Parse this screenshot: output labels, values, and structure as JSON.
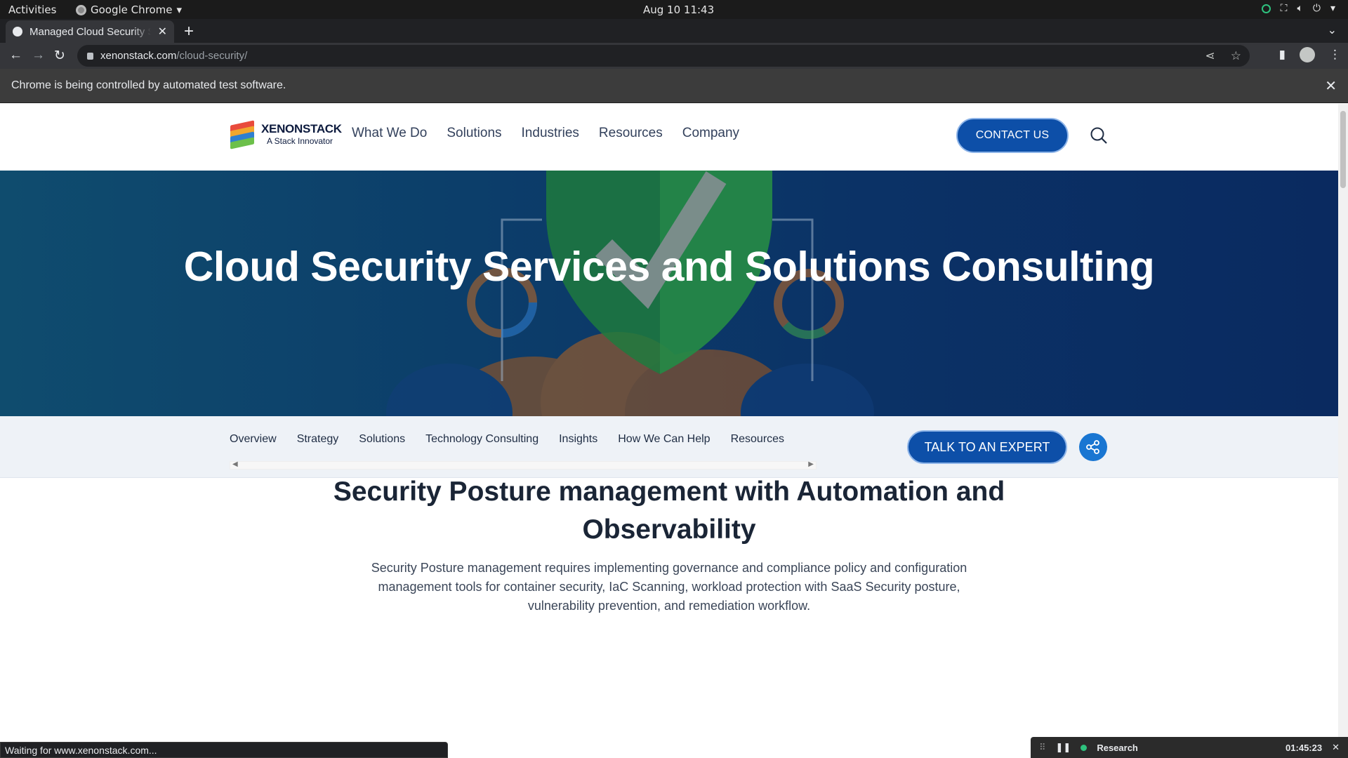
{
  "os": {
    "activities": "Activities",
    "app_name": "Google Chrome",
    "clock": "Aug 10  11:43"
  },
  "browser": {
    "tab_title": "Managed Cloud Security Services",
    "new_tab_symbol": "+",
    "url_host": "xenonstack.com",
    "url_path": "/cloud-security/",
    "infobar_message": "Chrome is being controlled by automated test software.",
    "status_text": "Waiting for www.xenonstack.com..."
  },
  "site": {
    "logo_brand": "XENONSTACK",
    "logo_tagline": "A Stack Innovator",
    "nav": [
      "What We Do",
      "Solutions",
      "Industries",
      "Resources",
      "Company"
    ],
    "contact_label": "CONTACT US",
    "hero_title": "Cloud Security Services and Solutions Consulting",
    "subnav": [
      "Overview",
      "Strategy",
      "Solutions",
      "Technology Consulting",
      "Insights",
      "How We Can Help",
      "Resources"
    ],
    "expert_label": "TALK TO AN EXPERT",
    "section_title": "Security Posture management with Automation and Observability",
    "section_body": "Security Posture management requires implementing governance and compliance policy and configuration management tools for container security, IaC Scanning, workload protection with SaaS Security posture, vulnerability prevention, and remediation workflow."
  },
  "recorder": {
    "label": "Research",
    "time": "01:45:23"
  },
  "colors": {
    "brand_blue": "#0d4fa8",
    "hero_bg": "#0c3e6a",
    "shield_green": "#1f7a3e"
  }
}
